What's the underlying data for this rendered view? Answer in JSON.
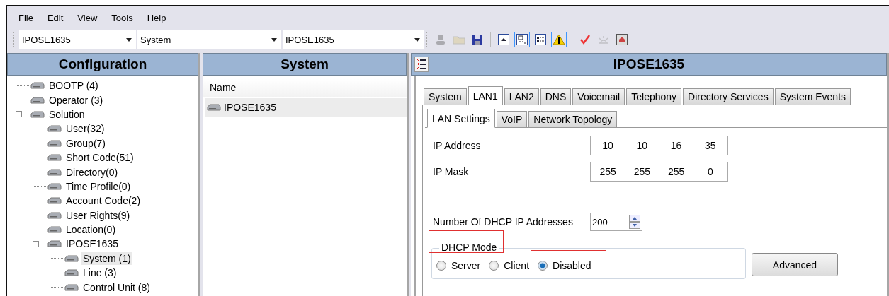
{
  "menu": [
    "File",
    "Edit",
    "View",
    "Tools",
    "Help"
  ],
  "toolbar": {
    "combos": [
      {
        "value": "IPOSE1635"
      },
      {
        "value": "System"
      },
      {
        "value": "IPOSE1635"
      }
    ],
    "buttons": [
      {
        "kind": "user",
        "pressed": false,
        "disabled": true
      },
      {
        "kind": "open",
        "pressed": false,
        "disabled": true
      },
      {
        "kind": "save",
        "pressed": false,
        "disabled": false
      },
      {
        "kind": "sep"
      },
      {
        "kind": "up",
        "pressed": false,
        "disabled": false
      },
      {
        "kind": "tree",
        "pressed": true,
        "disabled": false
      },
      {
        "kind": "list",
        "pressed": true,
        "disabled": false
      },
      {
        "kind": "warning",
        "pressed": true,
        "disabled": false
      },
      {
        "kind": "sep"
      },
      {
        "kind": "check",
        "pressed": false,
        "disabled": false
      },
      {
        "kind": "bulb",
        "pressed": false,
        "disabled": true
      },
      {
        "kind": "home",
        "pressed": false,
        "disabled": false
      }
    ]
  },
  "configuration": {
    "title": "Configuration",
    "tree": [
      {
        "label": "BOOTP (4)",
        "selected": false
      },
      {
        "label": "Operator (3)",
        "selected": false
      },
      {
        "label": "Solution",
        "selected": false,
        "expanded": true,
        "children": [
          {
            "label": "User(32)",
            "selected": false
          },
          {
            "label": "Group(7)",
            "selected": false
          },
          {
            "label": "Short Code(51)",
            "selected": false
          },
          {
            "label": "Directory(0)",
            "selected": false
          },
          {
            "label": "Time Profile(0)",
            "selected": false
          },
          {
            "label": "Account Code(2)",
            "selected": false
          },
          {
            "label": "User Rights(9)",
            "selected": false
          },
          {
            "label": "Location(0)",
            "selected": false
          },
          {
            "label": "IPOSE1635",
            "selected": false,
            "expanded": true,
            "children": [
              {
                "label": "System (1)",
                "selected": true
              },
              {
                "label": "Line (3)",
                "selected": false
              },
              {
                "label": "Control Unit (8)",
                "selected": false
              }
            ]
          }
        ]
      }
    ]
  },
  "system_list": {
    "title": "System",
    "column": "Name",
    "rows": [
      {
        "name": "IPOSE1635",
        "selected": true
      }
    ]
  },
  "detail": {
    "title": "IPOSE1635",
    "tabs": [
      {
        "label": "System",
        "selected": false
      },
      {
        "label": "LAN1",
        "selected": true
      },
      {
        "label": "LAN2",
        "selected": false
      },
      {
        "label": "DNS",
        "selected": false
      },
      {
        "label": "Voicemail",
        "selected": false
      },
      {
        "label": "Telephony",
        "selected": false
      },
      {
        "label": "Directory Services",
        "selected": false
      },
      {
        "label": "System Events",
        "selected": false
      }
    ],
    "subtabs": [
      {
        "label": "LAN Settings",
        "selected": true
      },
      {
        "label": "VoIP",
        "selected": false
      },
      {
        "label": "Network Topology",
        "selected": false
      }
    ],
    "ip_address": {
      "label": "IP Address",
      "octets": [
        "10",
        "10",
        "16",
        "35"
      ]
    },
    "ip_mask": {
      "label": "IP Mask",
      "octets": [
        "255",
        "255",
        "255",
        "0"
      ]
    },
    "dhcp_count": {
      "label": "Number Of DHCP IP Addresses",
      "value": "200"
    },
    "dhcp_mode": {
      "label": "DHCP Mode",
      "highlighted": true,
      "options": [
        {
          "label": "Server",
          "selected": false,
          "highlighted": false
        },
        {
          "label": "Client",
          "selected": false,
          "highlighted": false
        },
        {
          "label": "Disabled",
          "selected": true,
          "highlighted": true
        }
      ]
    },
    "advanced_button": "Advanced"
  }
}
